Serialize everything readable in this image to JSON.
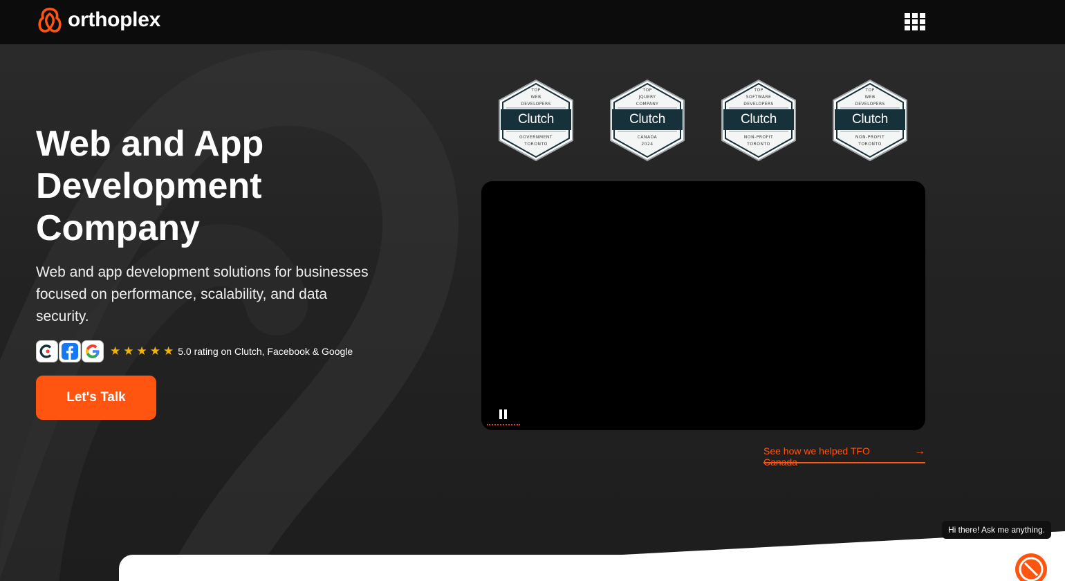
{
  "header": {
    "logo_text": "orthoplex",
    "menu_icon": "grid-menu-icon"
  },
  "hero": {
    "title_line1": "Web and App",
    "title_line2": "Development",
    "title_line3": "Company",
    "subtitle": "Web and app development solutions for businesses focused on performance, scalability, and data security.",
    "rating_icons": [
      "clutch-icon",
      "facebook-icon",
      "google-icon"
    ],
    "stars": [
      "★",
      "★",
      "★",
      "★",
      "★"
    ],
    "rating_text": "5.0 rating on Clutch, Facebook & Google",
    "cta_label": "Let's Talk"
  },
  "badges": [
    {
      "top_line1": "TOP",
      "top_line2": "WEB",
      "top_line3": "DEVELOPERS",
      "brand": "Clutch",
      "bottom_line1": "GOVERNMENT",
      "bottom_line2": "TORONTO"
    },
    {
      "top_line1": "TOP",
      "top_line2": "JQUERY",
      "top_line3": "COMPANY",
      "brand": "Clutch",
      "bottom_line1": "CANADA",
      "bottom_line2": "2024"
    },
    {
      "top_line1": "TOP",
      "top_line2": "SOFTWARE",
      "top_line3": "DEVELOPERS",
      "brand": "Clutch",
      "bottom_line1": "NON-PROFIT",
      "bottom_line2": "TORONTO"
    },
    {
      "top_line1": "TOP",
      "top_line2": "WEB",
      "top_line3": "DEVELOPERS",
      "brand": "Clutch",
      "bottom_line1": "NON-PROFIT",
      "bottom_line2": "TORONTO"
    }
  ],
  "video": {
    "control": "pause-icon"
  },
  "case_study": {
    "link_text": "See how we helped TFO Canada",
    "arrow": "→"
  },
  "chat": {
    "bubble_text": "Hi there! Ask me anything."
  },
  "colors": {
    "accent": "#ff5510",
    "header_bg": "#0c0c0c",
    "hero_bg": "#262626",
    "star": "#f5b400",
    "clutch_band": "#17313b"
  }
}
